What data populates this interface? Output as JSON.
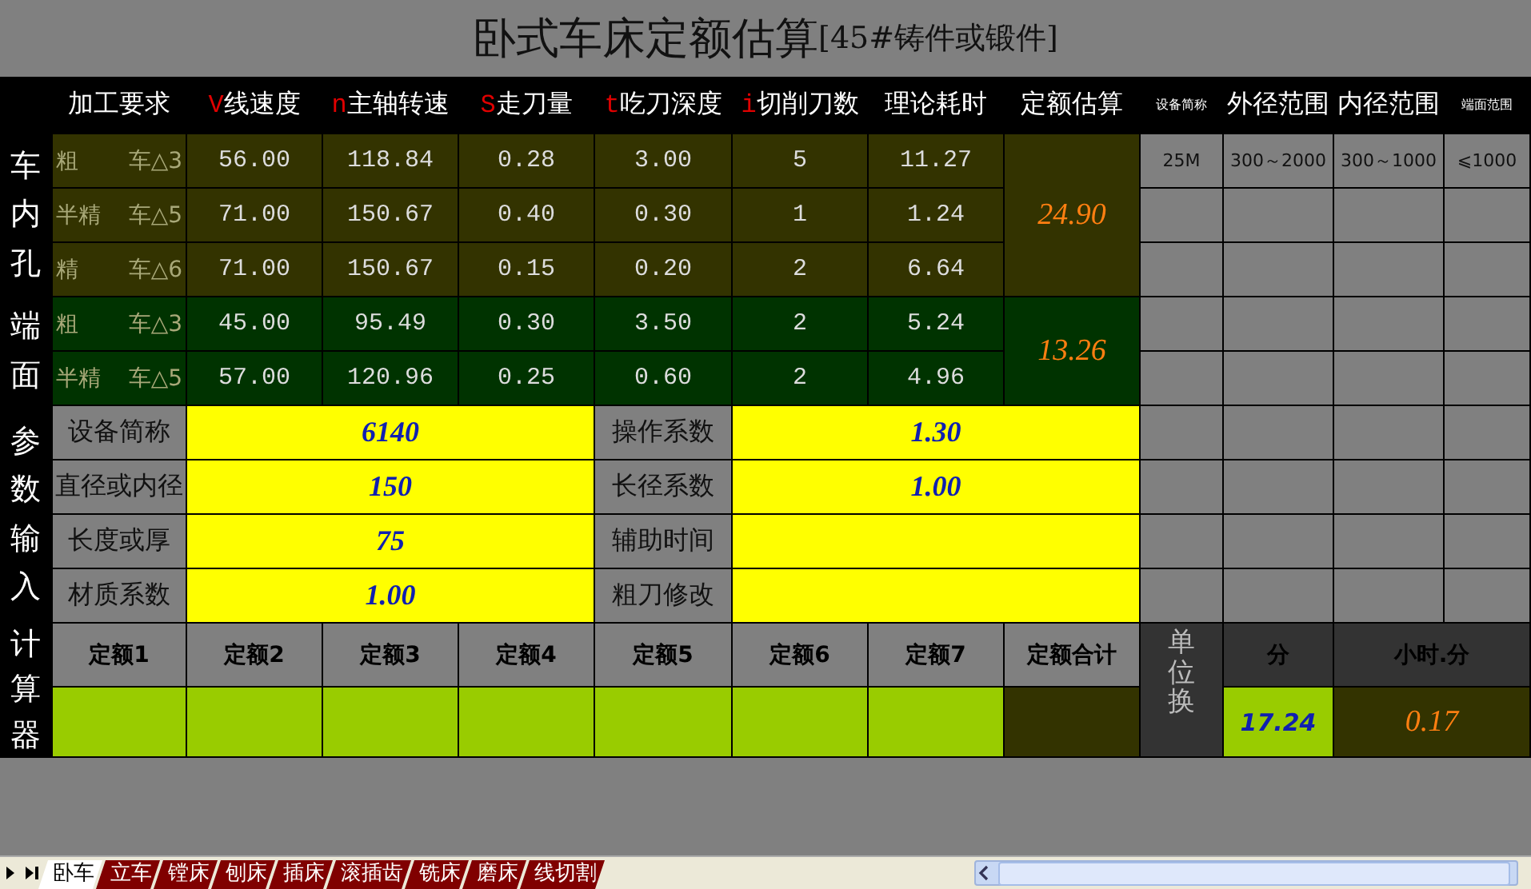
{
  "title": {
    "main": "卧式车床定额估算",
    "sub": "[45#铸件或锻件]"
  },
  "columns": [
    {
      "label": "加工要求"
    },
    {
      "mark": "V",
      "label": "线速度"
    },
    {
      "mark": "n",
      "label": "主轴转速"
    },
    {
      "mark": "S",
      "label": "走刀量"
    },
    {
      "mark": "t",
      "label": "吃刀深度"
    },
    {
      "mark": "i",
      "label": "切削刀数"
    },
    {
      "label": "理论耗时"
    },
    {
      "label": "定额估算"
    }
  ],
  "equipment": {
    "columns": [
      {
        "label": "设备简称"
      },
      {
        "label": "外径范围"
      },
      {
        "label": "内径范围"
      },
      {
        "label": "端面范围"
      }
    ],
    "row": [
      "25M",
      "300～2000",
      "300～1000",
      "⩽1000"
    ]
  },
  "groups": [
    {
      "label": "车内孔",
      "kind": "bore",
      "estimate": "24.90",
      "rows": [
        {
          "name": "粗",
          "grade": "车△3",
          "values": [
            "56.00",
            "118.84",
            "0.28",
            "3.00",
            "5",
            "11.27"
          ]
        },
        {
          "name": "半精",
          "grade": "车△5",
          "values": [
            "71.00",
            "150.67",
            "0.40",
            "0.30",
            "1",
            "1.24"
          ]
        },
        {
          "name": "精",
          "grade": "车△6",
          "values": [
            "71.00",
            "150.67",
            "0.15",
            "0.20",
            "2",
            "6.64"
          ]
        }
      ]
    },
    {
      "label": "端面",
      "kind": "face",
      "estimate": "13.26",
      "rows": [
        {
          "name": "粗",
          "grade": "车△3",
          "values": [
            "45.00",
            "95.49",
            "0.30",
            "3.50",
            "2",
            "5.24"
          ]
        },
        {
          "name": "半精",
          "grade": "车△5",
          "values": [
            "57.00",
            "120.96",
            "0.25",
            "0.60",
            "2",
            "4.96"
          ]
        }
      ]
    }
  ],
  "params": {
    "label": "参数输入",
    "rows": [
      {
        "left": {
          "label": "设备简称",
          "value": "6140"
        },
        "right": {
          "label": "操作系数",
          "value": "1.30"
        }
      },
      {
        "left": {
          "label": "直径或内径",
          "value": "150"
        },
        "right": {
          "label": "长径系数",
          "value": "1.00"
        }
      },
      {
        "left": {
          "label": "长度或厚",
          "value": "75"
        },
        "right": {
          "label": "辅助时间"
        }
      },
      {
        "left": {
          "label": "材质系数",
          "value": "1.00"
        },
        "right": {
          "label": "粗刀修改"
        }
      }
    ]
  },
  "calculator": {
    "label": "计算器",
    "quotas": [
      "定额1",
      "定额2",
      "定额3",
      "定额4",
      "定额5",
      "定额6",
      "定额7"
    ],
    "total_label": "定额合计"
  },
  "unit_conversion": {
    "label": "单位换",
    "units": [
      {
        "label": "分",
        "value": "17.24"
      },
      {
        "label": "小时.分",
        "value": "0.17"
      }
    ]
  },
  "tabs": [
    {
      "label": "卧车",
      "selected": true
    },
    {
      "label": "立车",
      "selected": false
    },
    {
      "label": "镗床",
      "selected": false
    },
    {
      "label": "刨床",
      "selected": false
    },
    {
      "label": "插床",
      "selected": false
    },
    {
      "label": "滚插齿",
      "selected": false
    },
    {
      "label": "铣床",
      "selected": false
    },
    {
      "label": "磨床",
      "selected": false
    },
    {
      "label": "线切割",
      "selected": false
    }
  ]
}
